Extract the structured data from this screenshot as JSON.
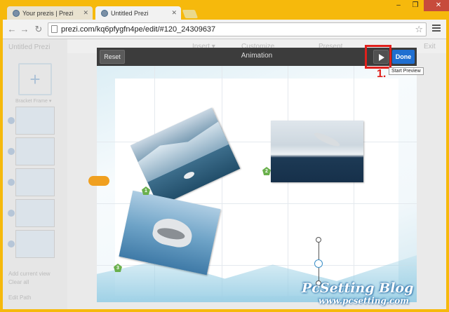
{
  "browser": {
    "tabs": [
      {
        "label": "Your prezis | Prezi"
      },
      {
        "label": "Untitled Prezi"
      }
    ],
    "url": "prezi.com/kq6pfygfn4pe/edit/#120_24309637",
    "window_controls": {
      "minimize": "–",
      "restore": "❐",
      "close": "✕"
    }
  },
  "editor": {
    "prezi_title": "Untitled Prezi",
    "header_items": [
      "Insert ▾",
      "Customize",
      "Present",
      "Exit"
    ],
    "sidebar": {
      "add_frame_label": "Bracket Frame ▾",
      "add_current_view": "Add current view",
      "clear_all": "Clear all",
      "edit_path": "Edit Path"
    }
  },
  "animation_bar": {
    "reset_label": "Reset",
    "title": "Animation",
    "done_label": "Done",
    "tooltip": "Start Preview"
  },
  "annotation": {
    "step_label": "1."
  },
  "badges": [
    "1",
    "2",
    "3"
  ],
  "watermark": {
    "title": "PcSetting Blog",
    "url": "www.pcsetting.com"
  },
  "colors": {
    "window_frame": "#f6b90c",
    "done_button": "#1f6fd1",
    "annotation_red": "#e0201c",
    "badge_green": "#6ab04c"
  }
}
